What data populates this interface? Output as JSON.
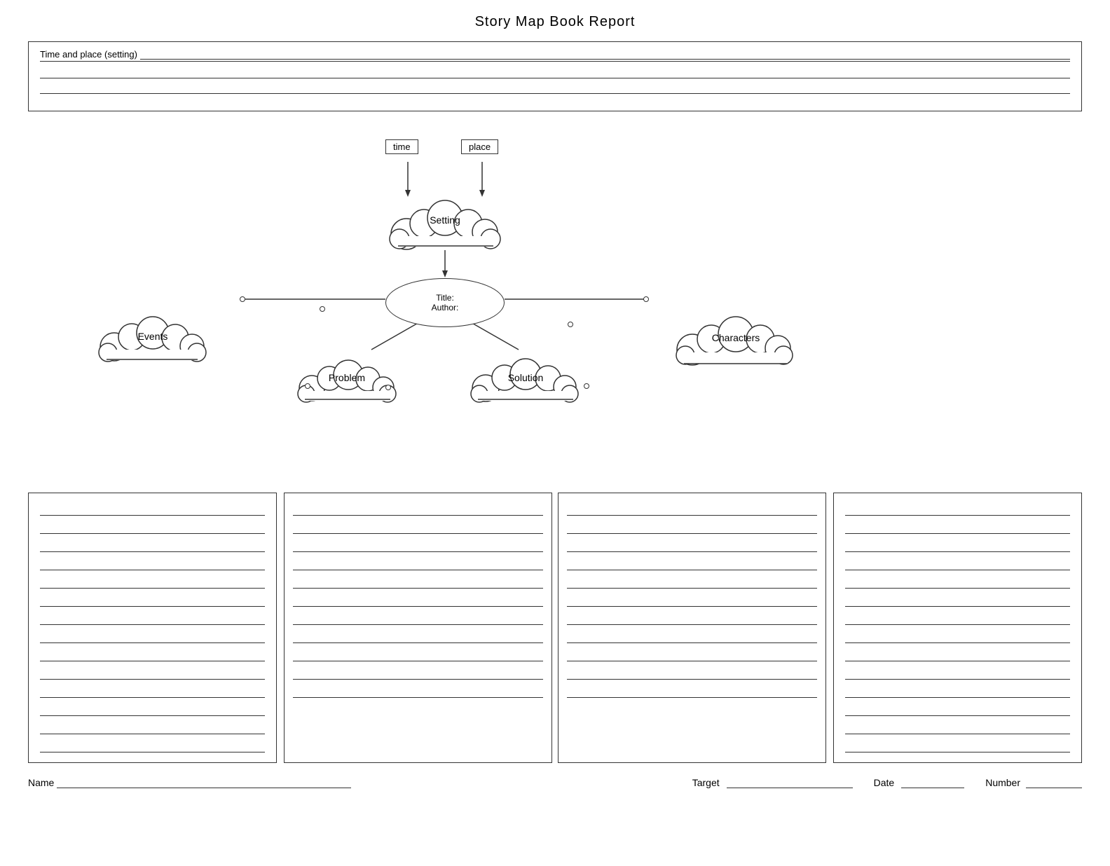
{
  "page": {
    "title": "Story Map Book Report"
  },
  "setting_box": {
    "label": "Time and place (setting)",
    "lines": 2
  },
  "labels": {
    "time": "time",
    "place": "place",
    "setting": "Setting",
    "events": "Events",
    "characters": "Characters",
    "title_field": "Title:",
    "author_field": "Author:",
    "problem": "Problem",
    "solution": "Solution"
  },
  "footer": {
    "name_label": "Name",
    "target_label": "Target",
    "date_label": "Date",
    "number_label": "Number"
  },
  "write_lines": {
    "events_count": 14,
    "problem_count": 11,
    "solution_count": 11,
    "characters_count": 14
  }
}
